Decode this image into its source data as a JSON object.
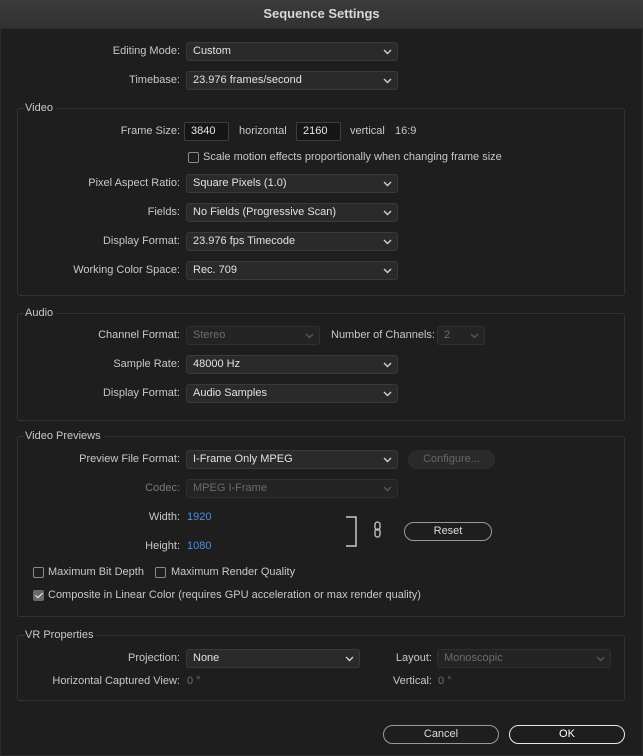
{
  "window": {
    "title": "Sequence Settings"
  },
  "general": {
    "editing_mode_label": "Editing Mode:",
    "editing_mode_value": "Custom",
    "timebase_label": "Timebase:",
    "timebase_value": "23.976  frames/second"
  },
  "video": {
    "section_title": "Video",
    "frame_size_label": "Frame Size:",
    "frame_width": "3840",
    "horizontal_label": "horizontal",
    "frame_height": "2160",
    "vertical_label": "vertical",
    "aspect_ratio": "16:9",
    "scale_motion_label": "Scale motion effects proportionally when changing frame size",
    "scale_motion_checked": false,
    "pixel_aspect_label": "Pixel Aspect Ratio:",
    "pixel_aspect_value": "Square Pixels (1.0)",
    "fields_label": "Fields:",
    "fields_value": "No Fields (Progressive Scan)",
    "display_format_label": "Display Format:",
    "display_format_value": "23.976 fps Timecode",
    "color_space_label": "Working Color Space:",
    "color_space_value": "Rec. 709"
  },
  "audio": {
    "section_title": "Audio",
    "channel_format_label": "Channel Format:",
    "channel_format_value": "Stereo",
    "num_channels_label": "Number of Channels:",
    "num_channels_value": "2",
    "sample_rate_label": "Sample Rate:",
    "sample_rate_value": "48000 Hz",
    "display_format_label": "Display Format:",
    "display_format_value": "Audio Samples"
  },
  "previews": {
    "section_title": "Video Previews",
    "preview_format_label": "Preview File Format:",
    "preview_format_value": "I-Frame Only MPEG",
    "configure_label": "Configure...",
    "codec_label": "Codec:",
    "codec_value": "MPEG I-Frame",
    "width_label": "Width:",
    "width_value": "1920",
    "height_label": "Height:",
    "height_value": "1080",
    "reset_label": "Reset",
    "max_bit_depth_label": "Maximum Bit Depth",
    "max_bit_depth_checked": false,
    "max_render_label": "Maximum Render Quality",
    "max_render_checked": false,
    "linear_color_label": "Composite in Linear Color (requires GPU acceleration or max render quality)",
    "linear_color_checked": true
  },
  "vr": {
    "section_title": "VR Properties",
    "projection_label": "Projection:",
    "projection_value": "None",
    "layout_label": "Layout:",
    "layout_value": "Monoscopic",
    "h_view_label": "Horizontal Captured View:",
    "h_view_value": "0 °",
    "v_label": "Vertical:",
    "v_value": "0 °"
  },
  "footer": {
    "cancel_label": "Cancel",
    "ok_label": "OK"
  },
  "colors": {
    "accent_blue": "#4a90e2",
    "background": "#1e1e1e"
  }
}
